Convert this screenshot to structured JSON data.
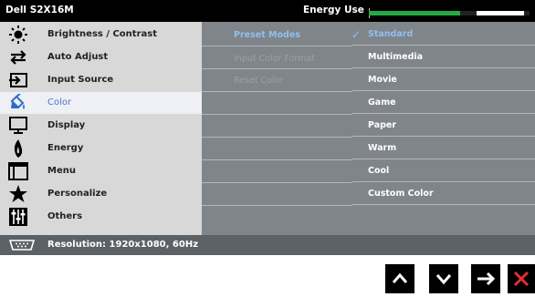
{
  "titlebar": {
    "model": "Dell S2X16M",
    "energy_label": "Energy Use",
    "energy_level_fraction": 0.57
  },
  "menu": {
    "items": [
      {
        "label": "Brightness / Contrast",
        "icon": "brightness-icon"
      },
      {
        "label": "Auto Adjust",
        "icon": "auto-adjust-icon"
      },
      {
        "label": "Input Source",
        "icon": "input-source-icon"
      },
      {
        "label": "Color",
        "icon": "color-icon",
        "active": true
      },
      {
        "label": "Display",
        "icon": "display-icon"
      },
      {
        "label": "Energy",
        "icon": "energy-icon"
      },
      {
        "label": "Menu",
        "icon": "menu-icon"
      },
      {
        "label": "Personalize",
        "icon": "star-icon"
      },
      {
        "label": "Others",
        "icon": "others-icon"
      }
    ]
  },
  "submenu": {
    "items": [
      {
        "label": "Preset Modes",
        "state": "highlighted"
      },
      {
        "label": "Input Color Format",
        "state": "disabled"
      },
      {
        "label": "Reset Color",
        "state": "disabled"
      }
    ]
  },
  "options": {
    "items": [
      {
        "label": "Standard",
        "selected": true
      },
      {
        "label": "Multimedia"
      },
      {
        "label": "Movie"
      },
      {
        "label": "Game"
      },
      {
        "label": "Paper"
      },
      {
        "label": "Warm"
      },
      {
        "label": "Cool"
      },
      {
        "label": "Custom Color"
      }
    ],
    "check_mark": "✓"
  },
  "statusbar": {
    "label": "Resolution: 1920x1080, 60Hz",
    "icon": "video-connector-icon"
  },
  "nav": {
    "buttons": [
      {
        "name": "up",
        "icon": "chevron-up-icon"
      },
      {
        "name": "down",
        "icon": "chevron-down-icon"
      },
      {
        "name": "right",
        "icon": "arrow-right-icon"
      },
      {
        "name": "exit",
        "icon": "close-icon"
      }
    ]
  },
  "colors": {
    "highlight": "#8fc0f0",
    "active_bg": "#eef0f6",
    "energy_green": "#27a844",
    "exit_red": "#e03030"
  }
}
